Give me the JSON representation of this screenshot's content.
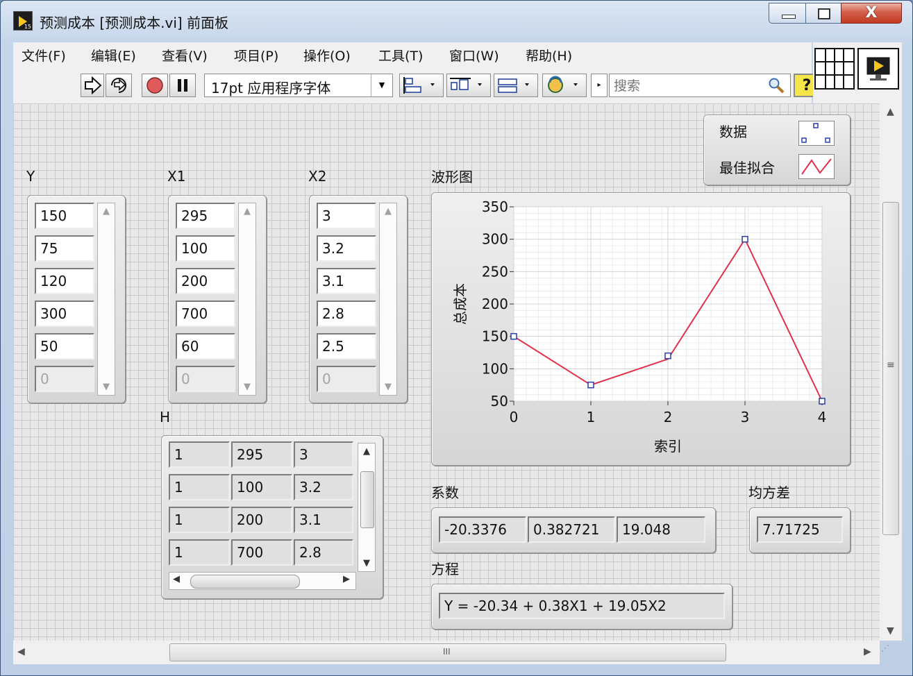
{
  "window": {
    "title": "预测成本 [预测成本.vi] 前面板",
    "close_glyph": "X"
  },
  "menu": [
    "文件(F)",
    "编辑(E)",
    "查看(V)",
    "项目(P)",
    "操作(O)",
    "工具(T)",
    "窗口(W)",
    "帮助(H)"
  ],
  "toolbar": {
    "font": "17pt 应用程序字体",
    "search_placeholder": "搜索",
    "help_glyph": "?"
  },
  "controls": {
    "Y": {
      "label": "Y",
      "values": [
        "150",
        "75",
        "120",
        "300",
        "50"
      ],
      "empty": "0"
    },
    "X1": {
      "label": "X1",
      "values": [
        "295",
        "100",
        "200",
        "700",
        "60"
      ],
      "empty": "0"
    },
    "X2": {
      "label": "X2",
      "values": [
        "3",
        "3.2",
        "3.1",
        "2.8",
        "2.5"
      ],
      "empty": "0"
    }
  },
  "matrix_H": {
    "label": "H",
    "rows": [
      [
        "1",
        "295",
        "3"
      ],
      [
        "1",
        "100",
        "3.2"
      ],
      [
        "1",
        "200",
        "3.1"
      ],
      [
        "1",
        "700",
        "2.8"
      ]
    ]
  },
  "legend": {
    "items": [
      "数据",
      "最佳拟合"
    ]
  },
  "graph": {
    "label": "波形图"
  },
  "chart_data": {
    "type": "line",
    "xlabel": "索引",
    "ylabel": "总成本",
    "xlim": [
      0,
      4
    ],
    "ylim": [
      50,
      350
    ],
    "x_ticks": [
      0,
      1,
      2,
      3,
      4
    ],
    "y_ticks": [
      50,
      100,
      150,
      200,
      250,
      300,
      350
    ],
    "grid": true,
    "legend_position": "top-right",
    "series": [
      {
        "name": "数据",
        "style": "markers",
        "color": "#2a3ca8",
        "x": [
          0,
          1,
          2,
          3,
          4
        ],
        "y": [
          150,
          75,
          120,
          300,
          50
        ]
      },
      {
        "name": "最佳拟合",
        "style": "line",
        "color": "#e0304a",
        "x": [
          0,
          1,
          2,
          3,
          4
        ],
        "y": [
          150,
          75,
          115,
          300,
          50
        ]
      }
    ]
  },
  "coefficients": {
    "label": "系数",
    "values": [
      "-20.3376",
      "0.382721",
      "19.048"
    ]
  },
  "mse": {
    "label": "均方差",
    "value": "7.71725"
  },
  "equation": {
    "label": "方程",
    "value": "Y = -20.34 + 0.38X1 + 19.05X2"
  },
  "hscroll_grip": "III",
  "vscroll_grip": "≡"
}
